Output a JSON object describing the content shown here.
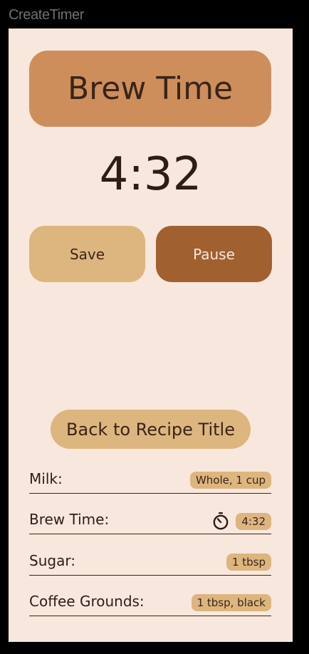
{
  "window": {
    "title": "CreateTimer"
  },
  "header": {
    "title": "Brew Time"
  },
  "timer": {
    "display": "4:32"
  },
  "controls": {
    "save_label": "Save",
    "pause_label": "Pause"
  },
  "back": {
    "label": "Back to Recipe Title"
  },
  "ingredients": [
    {
      "label": "Milk:",
      "value": "Whole, 1 cup"
    },
    {
      "label": "Brew Time:",
      "value": "4:32",
      "icon": "timer-icon"
    },
    {
      "label": "Sugar:",
      "value": "1 tbsp"
    },
    {
      "label": "Coffee Grounds:",
      "value": "1 tbsp, black"
    }
  ],
  "colors": {
    "background": "#f8e7dc",
    "title_card": "#cd8e5c",
    "save_button": "#ddb57f",
    "pause_button": "#a0602f",
    "chip": "#ddb57f",
    "text": "#2d1d16"
  }
}
